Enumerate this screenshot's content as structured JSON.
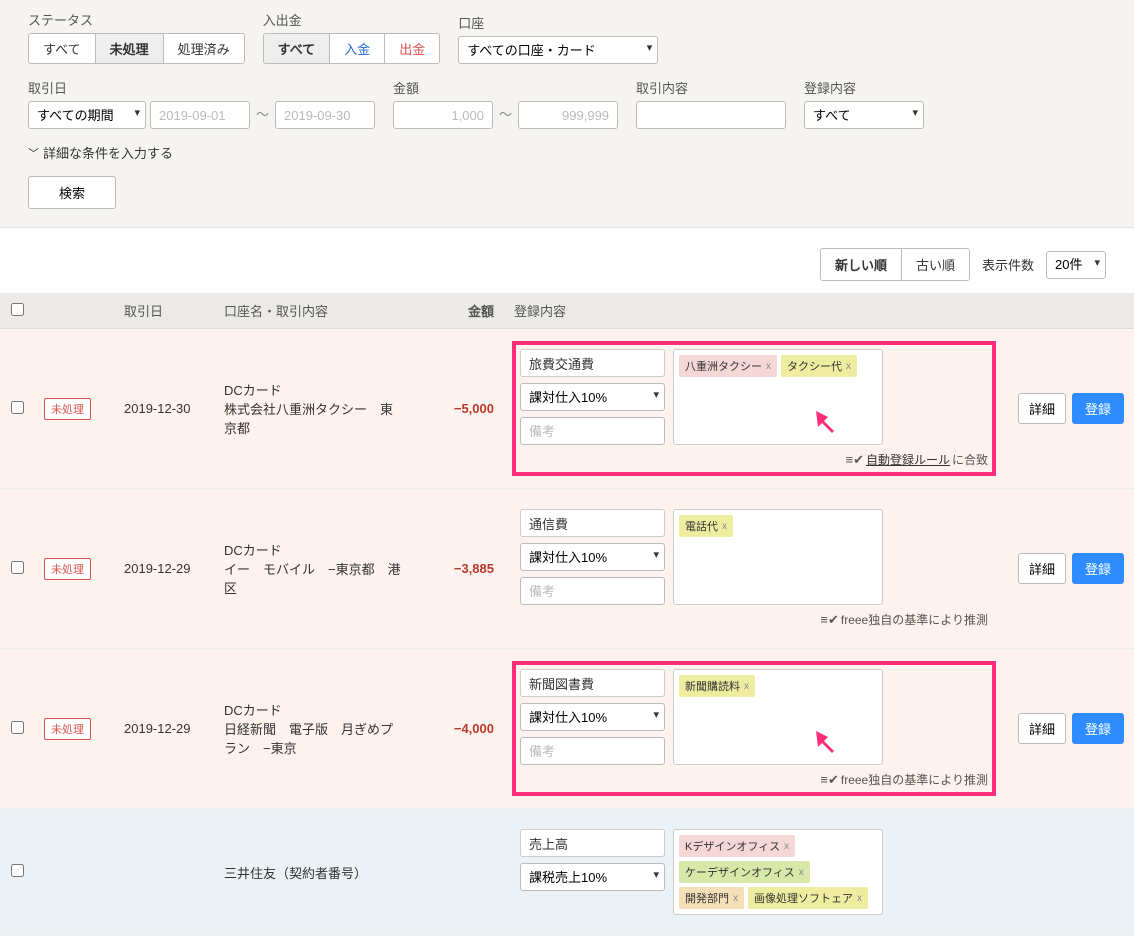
{
  "filters": {
    "status": {
      "label": "ステータス",
      "options": [
        "すべて",
        "未処理",
        "処理済み"
      ],
      "activeIndex": 1
    },
    "io": {
      "label": "入出金",
      "options": [
        "すべて",
        "入金",
        "出金"
      ],
      "activeIndex": 0
    },
    "account": {
      "label": "口座",
      "value": "すべての口座・カード"
    },
    "period": {
      "label": "取引日",
      "value": "すべての期間",
      "fromPlaceholder": "2019-09-01",
      "toPlaceholder": "2019-09-30"
    },
    "amount": {
      "label": "金額",
      "fromPlaceholder": "1,000",
      "toPlaceholder": "999,999"
    },
    "txnContent": {
      "label": "取引内容"
    },
    "regContent": {
      "label": "登録内容",
      "value": "すべて"
    },
    "expand": "詳細な条件を入力する",
    "search": "検索"
  },
  "toolbar": {
    "sortNew": "新しい順",
    "sortOld": "古い順",
    "pageSizeLabel": "表示件数",
    "pageSize": "20件"
  },
  "table": {
    "headers": {
      "date": "取引日",
      "desc": "口座名・取引内容",
      "amount": "金額",
      "reg": "登録内容"
    }
  },
  "rows": [
    {
      "sign": "neg",
      "status": "未処理",
      "date": "2019-12-30",
      "desc1": "DCカード",
      "desc2": "株式会社八重洲タクシー　東京都",
      "amount": "−5,000",
      "category": "旅費交通費",
      "tax": "課対仕入10%",
      "remarkPlaceholder": "備考",
      "tags": [
        {
          "text": "八重洲タクシー",
          "cls": "tag-pink"
        },
        {
          "text": "タクシー代",
          "cls": "tag-yellow"
        }
      ],
      "note": {
        "prefix": "",
        "link": "自動登録ルール",
        "suffix": "に合致"
      },
      "highlight": true,
      "arrow": true,
      "detail": "詳細",
      "register": "登録"
    },
    {
      "sign": "neg",
      "status": "未処理",
      "date": "2019-12-29",
      "desc1": "DCカード",
      "desc2": "イー　モバイル　−東京都　港区",
      "amount": "−3,885",
      "category": "通信費",
      "tax": "課対仕入10%",
      "remarkPlaceholder": "備考",
      "tags": [
        {
          "text": "電話代",
          "cls": "tag-yellow"
        }
      ],
      "note": {
        "prefix": "",
        "link": "",
        "suffix": "freee独自の基準により推測"
      },
      "highlight": false,
      "arrow": false,
      "detail": "詳細",
      "register": "登録"
    },
    {
      "sign": "neg",
      "status": "未処理",
      "date": "2019-12-29",
      "desc1": "DCカード",
      "desc2": "日経新聞　電子版　月ぎめプラン　−東京",
      "amount": "−4,000",
      "category": "新聞図書費",
      "tax": "課対仕入10%",
      "remarkPlaceholder": "備考",
      "tags": [
        {
          "text": "新聞購読料",
          "cls": "tag-yellow"
        }
      ],
      "note": {
        "prefix": "",
        "link": "",
        "suffix": "freee独自の基準により推測"
      },
      "highlight": true,
      "arrow": true,
      "detail": "詳細",
      "register": "登録"
    },
    {
      "sign": "pos",
      "status": "",
      "date": "",
      "desc1": "",
      "desc2": "三井住友（契約者番号）",
      "amount": "",
      "category": "売上高",
      "tax": "課税売上10%",
      "remarkPlaceholder": "",
      "tags": [
        {
          "text": "Kデザインオフィス",
          "cls": "tag-pink"
        },
        {
          "text": "ケーデザインオフィス",
          "cls": "tag-green"
        },
        {
          "text": "開発部門",
          "cls": "tag-orange"
        },
        {
          "text": "画像処理ソフトェア",
          "cls": "tag-yellow"
        }
      ],
      "note": null,
      "highlight": false,
      "arrow": false,
      "detail": "",
      "register": ""
    }
  ]
}
